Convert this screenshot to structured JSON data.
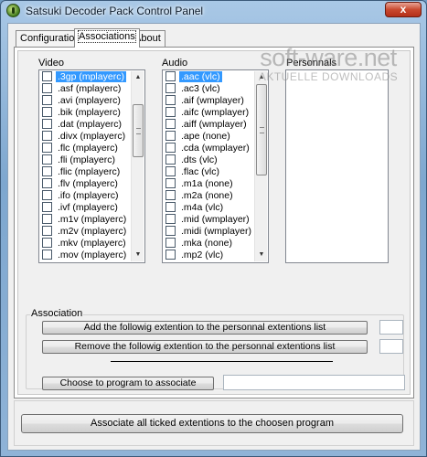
{
  "window": {
    "title": "Satsuki Decoder Pack Control Panel",
    "close_glyph": "x"
  },
  "watermark": {
    "main": "soft-ware.net",
    "sub": "AKTUELLE DOWNLOADS"
  },
  "tabs": [
    {
      "label": "Configuration",
      "active": false
    },
    {
      "label": "Associations",
      "active": true
    },
    {
      "label": "About",
      "active": false
    }
  ],
  "video": {
    "label": "Video",
    "selected_index": 0,
    "items": [
      ".3gp (mplayerc)",
      ".asf (mplayerc)",
      ".avi (mplayerc)",
      ".bik (mplayerc)",
      ".dat (mplayerc)",
      ".divx (mplayerc)",
      ".flc (mplayerc)",
      ".fli (mplayerc)",
      ".flic (mplayerc)",
      ".flv (mplayerc)",
      ".ifo (mplayerc)",
      ".ivf (mplayerc)",
      ".m1v (mplayerc)",
      ".m2v (mplayerc)",
      ".mkv (mplayerc)",
      ".mov (mplayerc)"
    ],
    "scroll_position": 0.18
  },
  "audio": {
    "label": "Audio",
    "selected_index": 0,
    "items": [
      ".aac (vlc)",
      ".ac3 (vlc)",
      ".aif (wmplayer)",
      ".aifc (wmplayer)",
      ".aiff (wmplayer)",
      ".ape (none)",
      ".cda (wmplayer)",
      ".dts (vlc)",
      ".flac (vlc)",
      ".m1a (none)",
      ".m2a (none)",
      ".m4a (vlc)",
      ".mid (wmplayer)",
      ".midi (wmplayer)",
      ".mka (none)",
      ".mp2 (vlc)"
    ],
    "scroll_position": 0.0
  },
  "personnals": {
    "label": "Personnals",
    "items": []
  },
  "association": {
    "title": "Association",
    "add_button": "Add the followig extention to the personnal extentions list",
    "remove_button": "Remove the followig extention to the personnal extentions list",
    "choose_button": "Choose to program to associate",
    "add_field_value": "",
    "remove_field_value": "",
    "program_field_value": ""
  },
  "associate_all_button": "Associate all ticked extentions to the choosen program"
}
